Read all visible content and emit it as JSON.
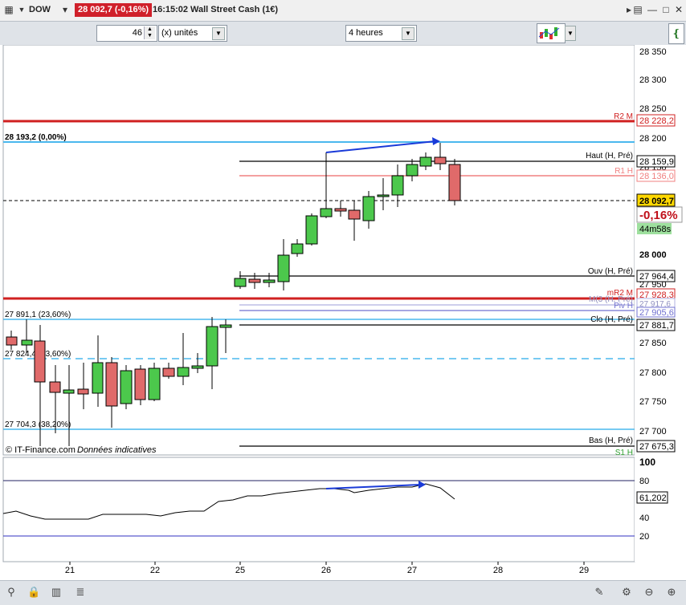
{
  "header": {
    "symbol": "DOW",
    "price_change": "28 092,7 (-0,16%)",
    "time": "16:15:02",
    "instrument": "Wall Street Cash (1€)"
  },
  "toolbar": {
    "quantity": "46",
    "unit": "(x) unités",
    "period": "4 heures"
  },
  "price_axis": {
    "ticks": [
      "28 350",
      "28 300",
      "28 250",
      "28 200",
      "28 150",
      "28 000",
      "27 950",
      "27 850",
      "27 800",
      "27 750",
      "27 700"
    ],
    "labels": {
      "r2": "28 228,2",
      "haut": "28 159,9",
      "r1": "28 136,0",
      "last": "28 092,7",
      "change": "-0,16%",
      "countdown": "44m58s",
      "ouv": "27 964,4",
      "mr2": "27 928,3",
      "m_a": "27 917,6",
      "piv": "27 905,6",
      "clo": "27 881,7",
      "bas": "27 675,3"
    }
  },
  "level_labels": {
    "r2": "R2 M",
    "haut": "Haut (H, Pré)",
    "r1": "R1 H",
    "ouv": "Ouv (H, Pré)",
    "mr2": "mR2 M",
    "m_a": "M(3 (H, Pré)",
    "piv": "Piv H",
    "clo": "Clo (H, Pré)",
    "bas": "Bas (H, Pré)",
    "s1": "S1 H"
  },
  "fib_labels": {
    "top": "28 193,2 (0,00%)",
    "f236": "27 891,1 (23,60%)",
    "f382a": "27 824,4 (23,60%)",
    "f382b": "27 704,3 (38,20%)"
  },
  "watermark": {
    "source": "© IT-Finance.com",
    "note": "Données indicatives"
  },
  "indicator": {
    "ticks": [
      "100",
      "80",
      "60",
      "40",
      "20"
    ],
    "value": "61,202"
  },
  "x_axis": {
    "labels": [
      "21",
      "22",
      "25",
      "26",
      "27",
      "28",
      "29"
    ]
  },
  "colors": {
    "up": "#4cc84c",
    "down": "#e06a6a",
    "r2": "#d02020",
    "fib": "#4ab8ee",
    "arrow": "#1a3ad8"
  }
}
